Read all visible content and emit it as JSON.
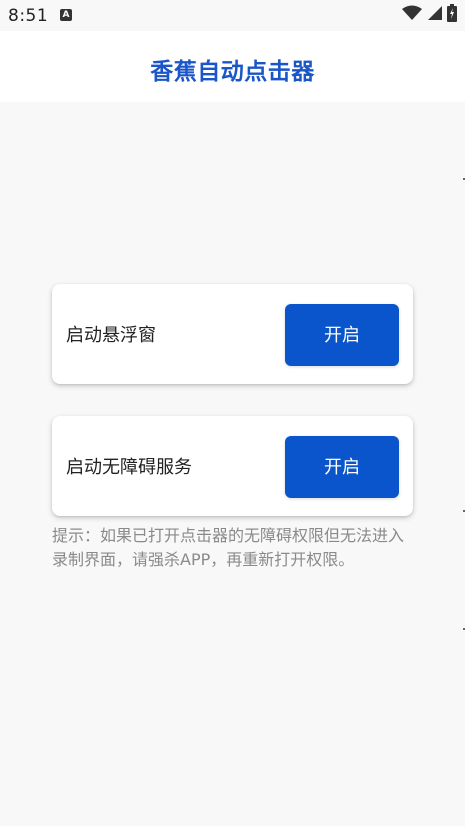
{
  "status_bar": {
    "time": "8:51",
    "notification_icon": "A",
    "icons": [
      "wifi-icon",
      "signal-icon",
      "battery-icon"
    ]
  },
  "app_bar": {
    "title": "香蕉自动点击器"
  },
  "cards": [
    {
      "label": "启动悬浮窗",
      "button_label": "开启"
    },
    {
      "label": "启动无障碍服务",
      "button_label": "开启"
    }
  ],
  "hint": "提示：如果已打开点击器的无障碍权限但无法进入录制界面，请强杀APP，再重新打开权限。",
  "colors": {
    "accent": "#1a56c7",
    "button": "#0a55cb",
    "background": "#f8f8f8",
    "hint_text": "#8a8a8a"
  }
}
